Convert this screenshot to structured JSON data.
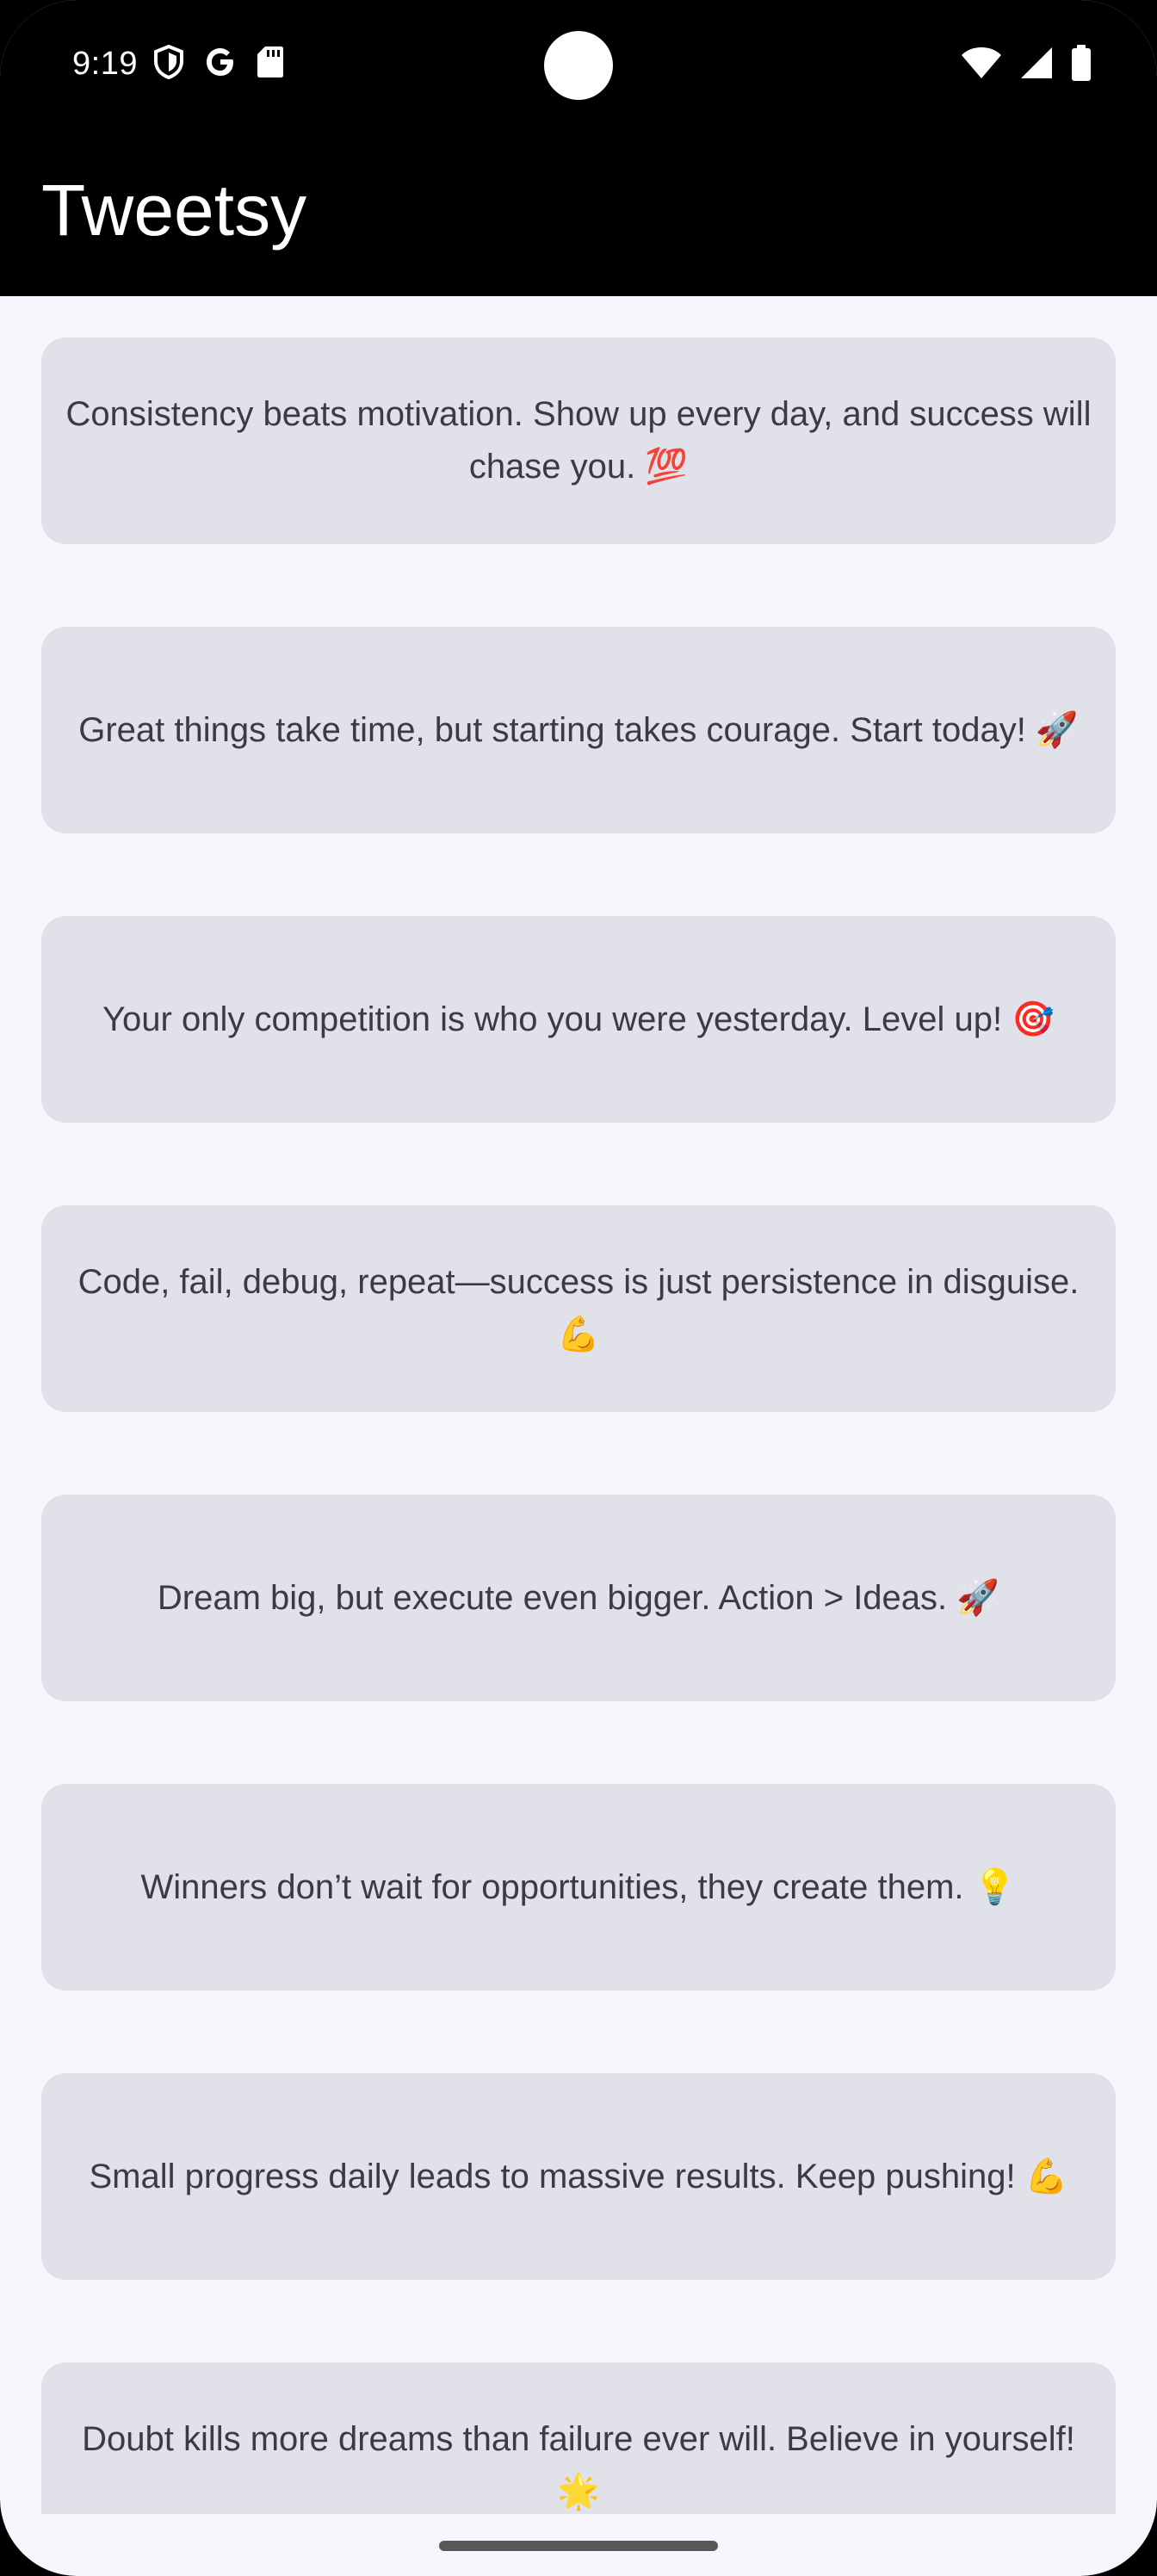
{
  "status_bar": {
    "time": "9:19",
    "icons_left": [
      "shield-icon",
      "google-icon",
      "sd-card-icon"
    ],
    "icons_right": [
      "wifi-icon",
      "signal-icon",
      "battery-icon"
    ]
  },
  "app_bar": {
    "title": "Tweetsy"
  },
  "tweets": [
    "Consistency beats motivation. Show up every day, and success will chase you. 💯",
    "Great things take time, but starting takes courage. Start today! 🚀",
    "Your only competition is who you were yesterday. Level up! 🎯",
    "Code, fail, debug, repeat—success is just persistence in disguise. 💪",
    "Dream big, but execute even bigger. Action > Ideas. 🚀",
    "Winners don’t wait for opportunities, they create them. 💡",
    "Small progress daily leads to massive results. Keep pushing! 💪",
    "Doubt kills more dreams than failure ever will. Believe in yourself! 🌟"
  ],
  "colors": {
    "app_bar_bg": "#000000",
    "screen_bg": "#f6f6fc",
    "card_bg": "#e1e1e9",
    "card_text": "#3b3b47"
  }
}
